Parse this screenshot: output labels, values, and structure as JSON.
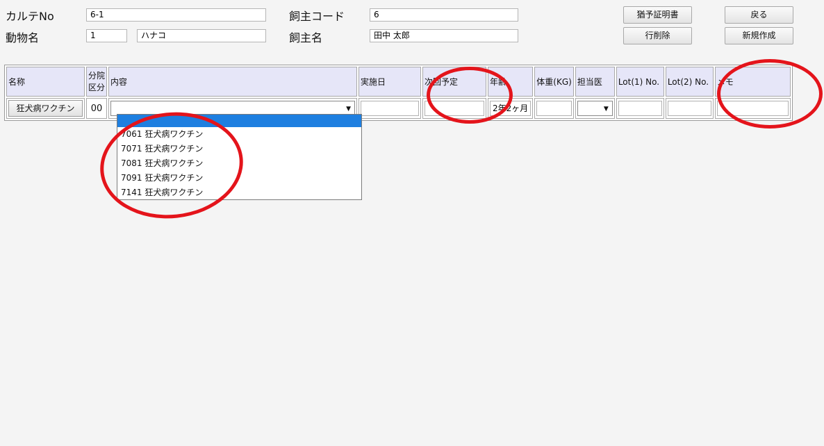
{
  "form": {
    "karte_no_label": "カルテNo",
    "karte_no_value": "6-1",
    "animal_name_label": "動物名",
    "animal_no_value": "1",
    "animal_name_value": "ハナコ",
    "owner_code_label": "飼主コード",
    "owner_code_value": "6",
    "owner_name_label": "飼主名",
    "owner_name_value": "田中 太郎"
  },
  "buttons": {
    "grace_certificate": "猶予証明書",
    "back": "戻る",
    "delete_row": "行削除",
    "new_create": "新規作成"
  },
  "table": {
    "headers": {
      "name": "名称",
      "category_line1": "分院",
      "category_line2": "区分",
      "content": "内容",
      "date_done": "実施日",
      "next_scheduled": "次回予定",
      "age": "年齢",
      "weight": "体重(KG)",
      "doctor": "担当医",
      "lot1": "Lot(1) No.",
      "lot2": "Lot(2) No.",
      "memo": "メモ"
    },
    "row": {
      "name_button": "狂犬病ワクチン",
      "category": "00",
      "content": "",
      "date_done": "",
      "next_scheduled": "",
      "age": "2年2ヶ月",
      "weight": "",
      "doctor": "",
      "lot1": "",
      "lot2": "",
      "memo": ""
    }
  },
  "dropdown": {
    "options": [
      "",
      "7061 狂犬病ワクチン",
      "7071 狂犬病ワクチン",
      "7081 狂犬病ワクチン",
      "7091 狂犬病ワクチン",
      "7141 狂犬病ワクチン"
    ]
  },
  "colors": {
    "annotation_ring": "#e4141b",
    "option_highlight": "#1e7fe0",
    "header_bg": "#e6e6f8"
  },
  "icons": {
    "select_arrow": "triangle-down-icon"
  }
}
